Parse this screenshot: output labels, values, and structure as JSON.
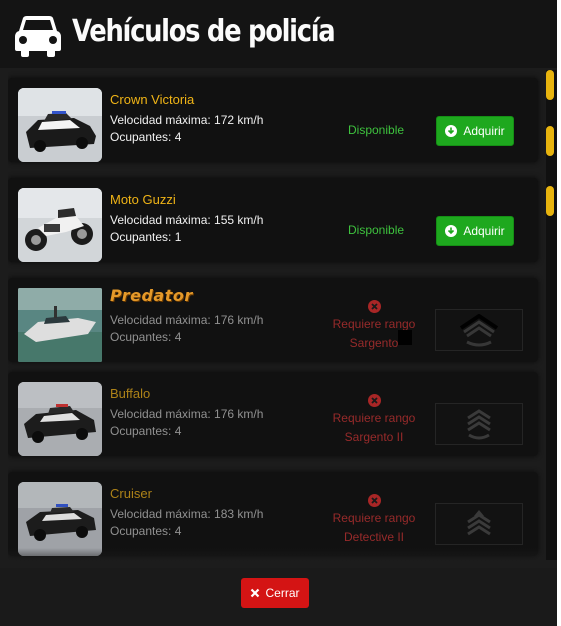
{
  "header": {
    "title": "Vehículos de policía",
    "icon": "car-icon"
  },
  "colors": {
    "accent_yellow": "#f0b416",
    "available_green": "#3ec23e",
    "buy_green": "#1ea81e",
    "locked_red": "#a02c2c",
    "close_red": "#d41414",
    "background": "#1c1c1c"
  },
  "vehicles": [
    {
      "name": "Crown Victoria",
      "speed": "Velocidad máxima: 172 km/h",
      "seats": "Ocupantes: 4",
      "status": "Disponible",
      "button_label": "Adquirir"
    },
    {
      "name": "Moto Guzzi",
      "speed": "Velocidad máxima: 155 km/h",
      "seats": "Ocupantes: 1",
      "status": "Disponible",
      "button_label": "Adquirir"
    },
    {
      "name": "Predator",
      "speed": "Velocidad máxima: 176 km/h",
      "seats": "Ocupantes: 4",
      "requirement_line1": "Requiere rango",
      "requirement_line2": "Sargento",
      "badge": "sergeant-chevron-icon"
    },
    {
      "name": "Buffalo",
      "speed": "Velocidad máxima: 176 km/h",
      "seats": "Ocupantes: 4",
      "requirement_line1": "Requiere rango",
      "requirement_line2": "Sargento II",
      "badge": "sergeant-ii-chevron-icon"
    },
    {
      "name": "Cruiser",
      "speed": "Velocidad máxima: 183 km/h",
      "seats": "Ocupantes: 4",
      "requirement_line1": "Requiere rango",
      "requirement_line2": "Detective II",
      "badge": "detective-ii-chevron-icon"
    }
  ],
  "footer": {
    "close_label": "Cerrar",
    "close_icon": "x-icon"
  }
}
